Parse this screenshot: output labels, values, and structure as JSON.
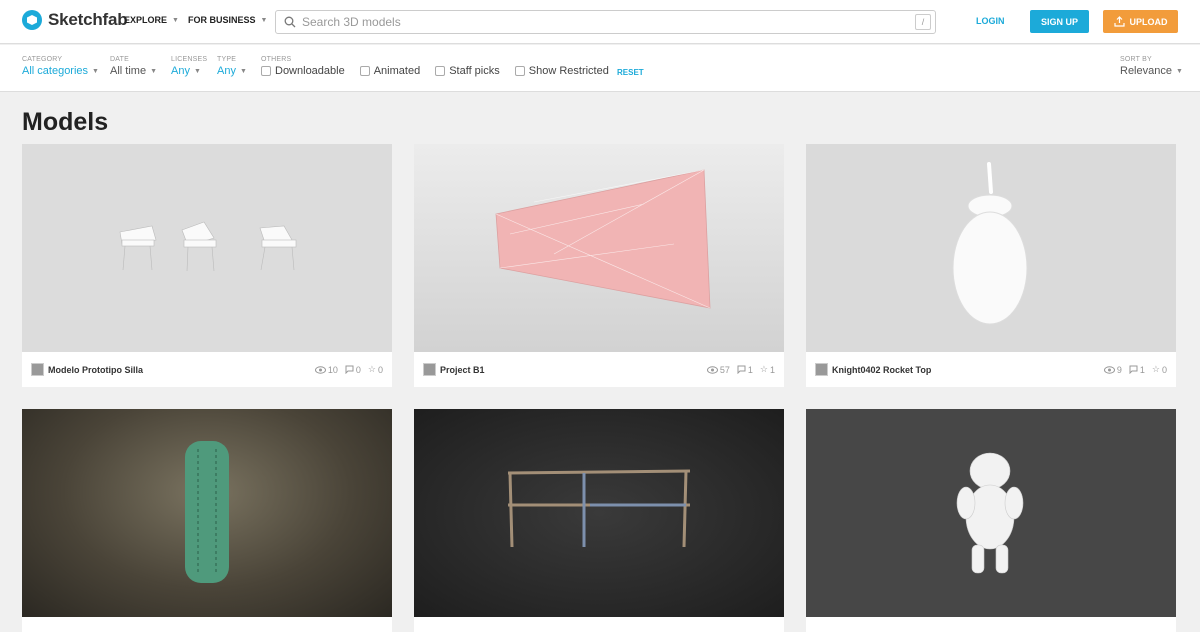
{
  "header": {
    "brand": "Sketchfab",
    "nav": [
      {
        "label": "EXPLORE"
      },
      {
        "label": "FOR BUSINESS"
      }
    ],
    "search_placeholder": "Search 3D models",
    "search_shortcut": "/",
    "login": "LOGIN",
    "signup": "SIGN UP",
    "upload": "UPLOAD"
  },
  "filters": {
    "category": {
      "label": "CATEGORY",
      "value": "All categories"
    },
    "date": {
      "label": "DATE",
      "value": "All time"
    },
    "licenses": {
      "label": "LICENSES",
      "value": "Any"
    },
    "type": {
      "label": "TYPE",
      "value": "Any"
    },
    "others": {
      "label": "OTHERS",
      "options": [
        "Downloadable",
        "Animated",
        "Staff picks",
        "Show Restricted"
      ]
    },
    "reset": "RESET",
    "sort": {
      "label": "SORT BY",
      "value": "Relevance"
    }
  },
  "main": {
    "title": "Models",
    "cards": [
      {
        "name": "Modelo Prototipo Silla",
        "views": "10",
        "comments": "0",
        "likes": "0"
      },
      {
        "name": "Project B1",
        "views": "57",
        "comments": "1",
        "likes": "1"
      },
      {
        "name": "Knight0402 Rocket Top",
        "views": "9",
        "comments": "1",
        "likes": "0"
      },
      {
        "name": "",
        "views": "",
        "comments": "",
        "likes": ""
      },
      {
        "name": "",
        "views": "",
        "comments": "",
        "likes": ""
      },
      {
        "name": "",
        "views": "",
        "comments": "",
        "likes": ""
      }
    ]
  },
  "colors": {
    "accent": "#1caad9",
    "upload": "#f29c3b"
  }
}
